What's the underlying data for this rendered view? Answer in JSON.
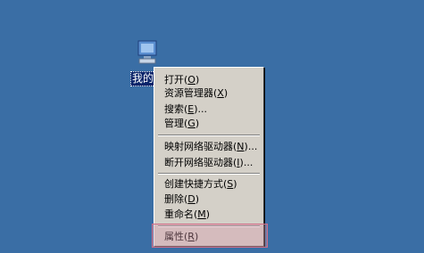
{
  "desktop": {
    "background_color": "#3a6ea5",
    "icon_label": "我的",
    "icon_name": "my-computer-icon"
  },
  "context_menu": {
    "items": [
      {
        "label": "打开",
        "accel": "O",
        "suffix": ""
      },
      {
        "label": "资源管理器",
        "accel": "X",
        "suffix": ""
      },
      {
        "label": "搜索",
        "accel": "E",
        "suffix": "..."
      },
      {
        "label": "管理",
        "accel": "G",
        "suffix": ""
      },
      {
        "label": "映射网络驱动器",
        "accel": "N",
        "suffix": "..."
      },
      {
        "label": "断开网络驱动器",
        "accel": "I",
        "suffix": "..."
      },
      {
        "label": "创建快捷方式",
        "accel": "S",
        "suffix": ""
      },
      {
        "label": "删除",
        "accel": "D",
        "suffix": ""
      },
      {
        "label": "重命名",
        "accel": "M",
        "suffix": ""
      },
      {
        "label": "属性",
        "accel": "R",
        "suffix": ""
      }
    ]
  },
  "highlight": {
    "target": "属性",
    "color": "#d06c86"
  }
}
